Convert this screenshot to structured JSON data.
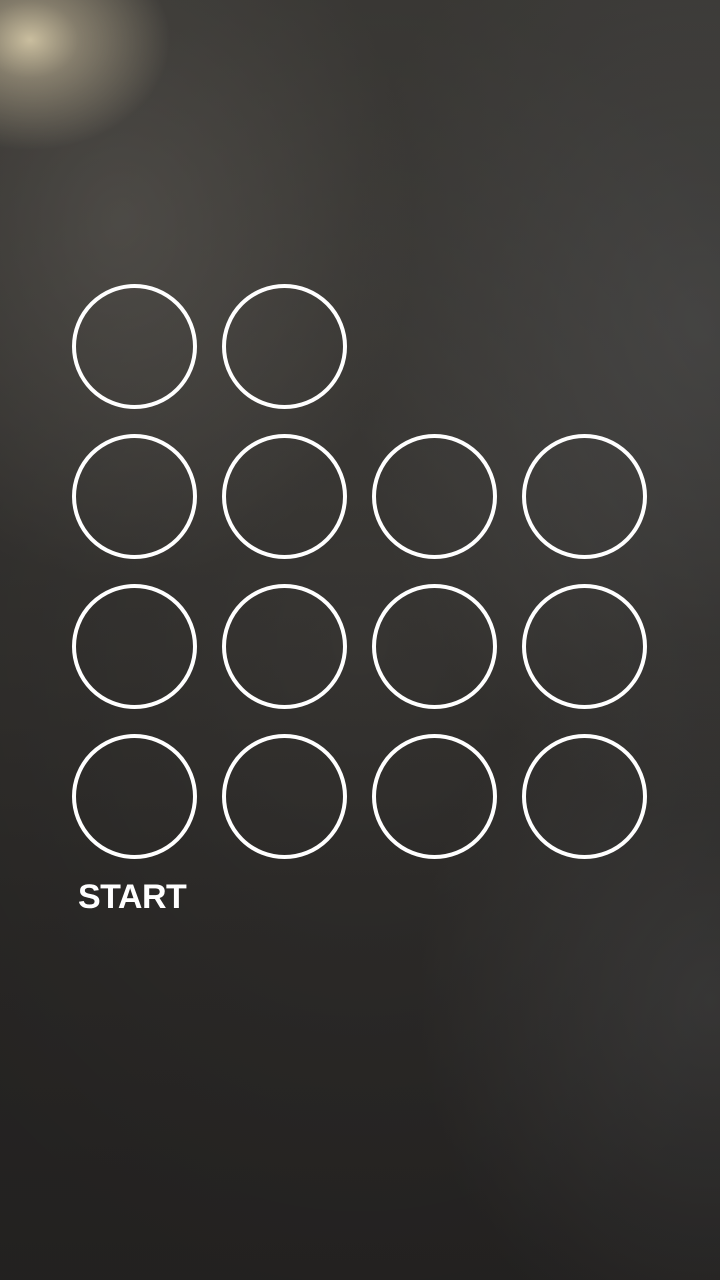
{
  "screen": {
    "name": "pattern-entry",
    "background": "camera-view",
    "ring_color": "#ffffff"
  },
  "rings": {
    "rows": [
      {
        "count": 2
      },
      {
        "count": 4
      },
      {
        "count": 4
      },
      {
        "count": 4
      }
    ]
  },
  "start_label": "START"
}
